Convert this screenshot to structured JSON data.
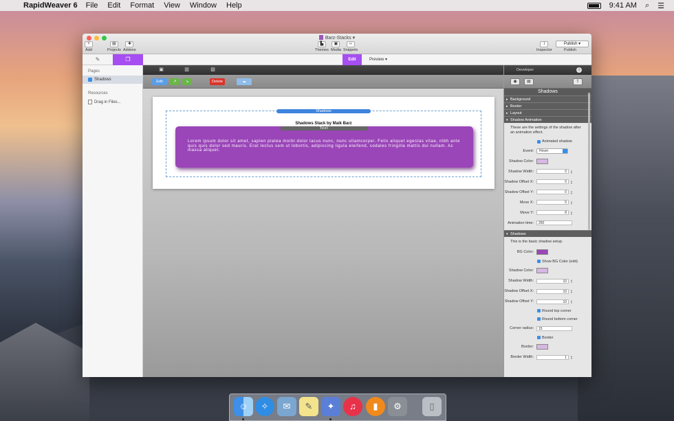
{
  "menubar": {
    "app_name": "RapidWeaver 6",
    "menus": [
      "File",
      "Edit",
      "Format",
      "View",
      "Window",
      "Help"
    ],
    "clock": "9:41 AM"
  },
  "window": {
    "title": "Barz-Stacks",
    "toolbar": {
      "add": "Add",
      "projects": "Projects",
      "addons": "Addons",
      "themes": "Themes",
      "media": "Media",
      "snippets": "Snippets",
      "inspector": "Inspector",
      "publish_button": "Publish",
      "publish_label": "Publish"
    },
    "modes": {
      "edit": "Edit",
      "preview": "Preview"
    }
  },
  "sidebar": {
    "pages_header": "Pages",
    "page_item": "Shadows",
    "resources_header": "Resources",
    "drag_item": "Drag in Files..."
  },
  "editor": {
    "buttons": {
      "edit": "Edit",
      "delete": "Delete"
    },
    "stack_badge": "Shadows",
    "stack_title": "Shadows Stack by Maik Barz",
    "text_badge": "Text",
    "body_text": "Lorem ipsum dolor sit amet, sapien platea morbi dolor lacus nunc, nunc ullamcorper. Felis aliquet egestas vitae, nibh ante quis quis dolor sed mauris. Erat lectus sem ut lobortis, adipiscing ligula eleifend, sodales fringilla mattis dui nullam. Ac massa aliquet."
  },
  "inspector": {
    "developer": "Developer",
    "heading": "Shadows",
    "sections": [
      "Background",
      "Border",
      "Layout"
    ],
    "animation": {
      "title": "Shadow Animation",
      "note": "These are the settings of the shadow after an animation effect.",
      "animated_label": "Animated shadow",
      "event_label": "Event:",
      "event_value": "Hover",
      "shadow_color_label": "Shadow Color:",
      "shadow_color": "#d7b8e3",
      "shadow_width_label": "Shadow Width:",
      "shadow_width": "0",
      "offset_x_label": "Shadow Offset X:",
      "offset_x": "0",
      "offset_y_label": "Shadow Offset Y:",
      "offset_y": "0",
      "move_x_label": "Move X:",
      "move_x": "5",
      "move_y_label": "Move Y:",
      "move_y": "8",
      "anim_time_label": "Animation time:",
      "anim_time": "250"
    },
    "shadows": {
      "title": "Shadows",
      "note": "This is the basic shadow setup.",
      "bg_color_label": "BG Color:",
      "bg_color": "#9a45b8",
      "show_bg_label": "Show BG Color (edit)",
      "shadow_color_label": "Shadow Color:",
      "shadow_color": "#d7b8e3",
      "shadow_width_label": "Shadow Width:",
      "shadow_width": "10",
      "offset_x_label": "Shadow Offset X:",
      "offset_x": "10",
      "offset_y_label": "Shadow Offset Y:",
      "offset_y": "10",
      "round_top_label": "Round top corner",
      "round_bottom_label": "Round bottom corner",
      "corner_radius_label": "Corner radius:",
      "corner_radius": "15",
      "border_check_label": "Border",
      "border_label": "Border:",
      "border_color": "#d7b8e3",
      "border_width_label": "Border Width:",
      "border_width": "1"
    }
  },
  "colors": {
    "accent": "#a64ef1",
    "delete": "#d9342b",
    "stack_blue": "#3e83de"
  }
}
